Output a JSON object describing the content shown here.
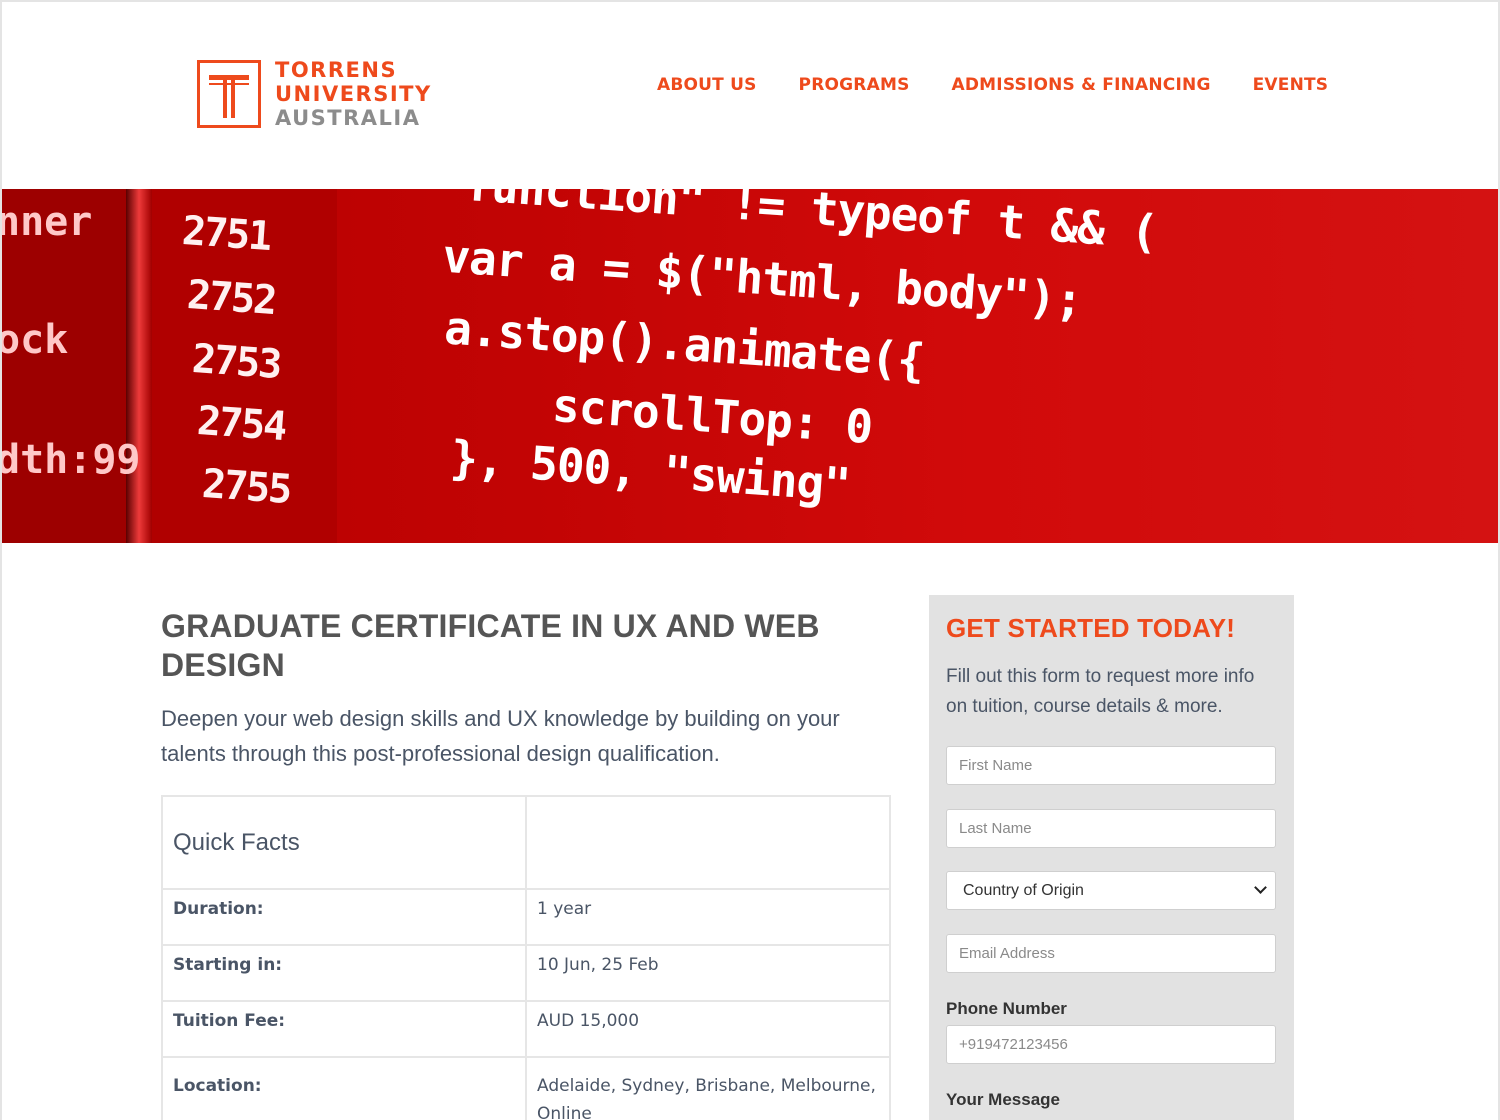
{
  "brand": {
    "line1": "TORRENS",
    "line2": "UNIVERSITY",
    "line3": "AUSTRALIA",
    "accent_color": "#ee4a1c"
  },
  "nav": {
    "items": [
      "ABOUT US",
      "PROGRAMS",
      "ADMISSIONS & FINANCING",
      "EVENTS"
    ]
  },
  "hero": {
    "image_text": {
      "gutter_lines": [
        "nner",
        "ock",
        "dth:99"
      ],
      "line_numbers": [
        "2751",
        "2752",
        "2753",
        "2754",
        "2755"
      ],
      "code_lines": [
        "function\" != typeof t && (",
        "var a = $(\"html, body\");",
        "a.stop().animate({",
        "scrollTop: 0",
        "}, 500, \"swing\""
      ]
    }
  },
  "main": {
    "title": "GRADUATE CERTIFICATE IN UX AND WEB DESIGN",
    "lede": "Deepen your web design skills and UX knowledge by building on your talents through this post-professional design qualification."
  },
  "quick_facts": {
    "heading": "Quick Facts",
    "rows": [
      {
        "label": "Duration:",
        "value": "1 year"
      },
      {
        "label": "Starting in:",
        "value": "10 Jun, 25 Feb"
      },
      {
        "label": "Tuition Fee:",
        "value": "AUD 15,000"
      },
      {
        "label": "Location:",
        "value": "Adelaide, Sydney, Brisbane, Melbourne, Online"
      }
    ]
  },
  "form": {
    "title": "GET STARTED TODAY!",
    "intro": "Fill out this form to request more info on tuition, course details & more.",
    "first_name_placeholder": "First Name",
    "last_name_placeholder": "Last Name",
    "country_selected": "Country of Origin",
    "email_placeholder": "Email Address",
    "phone_label": "Phone Number",
    "phone_placeholder": "+919472123456",
    "message_label": "Your Message"
  }
}
